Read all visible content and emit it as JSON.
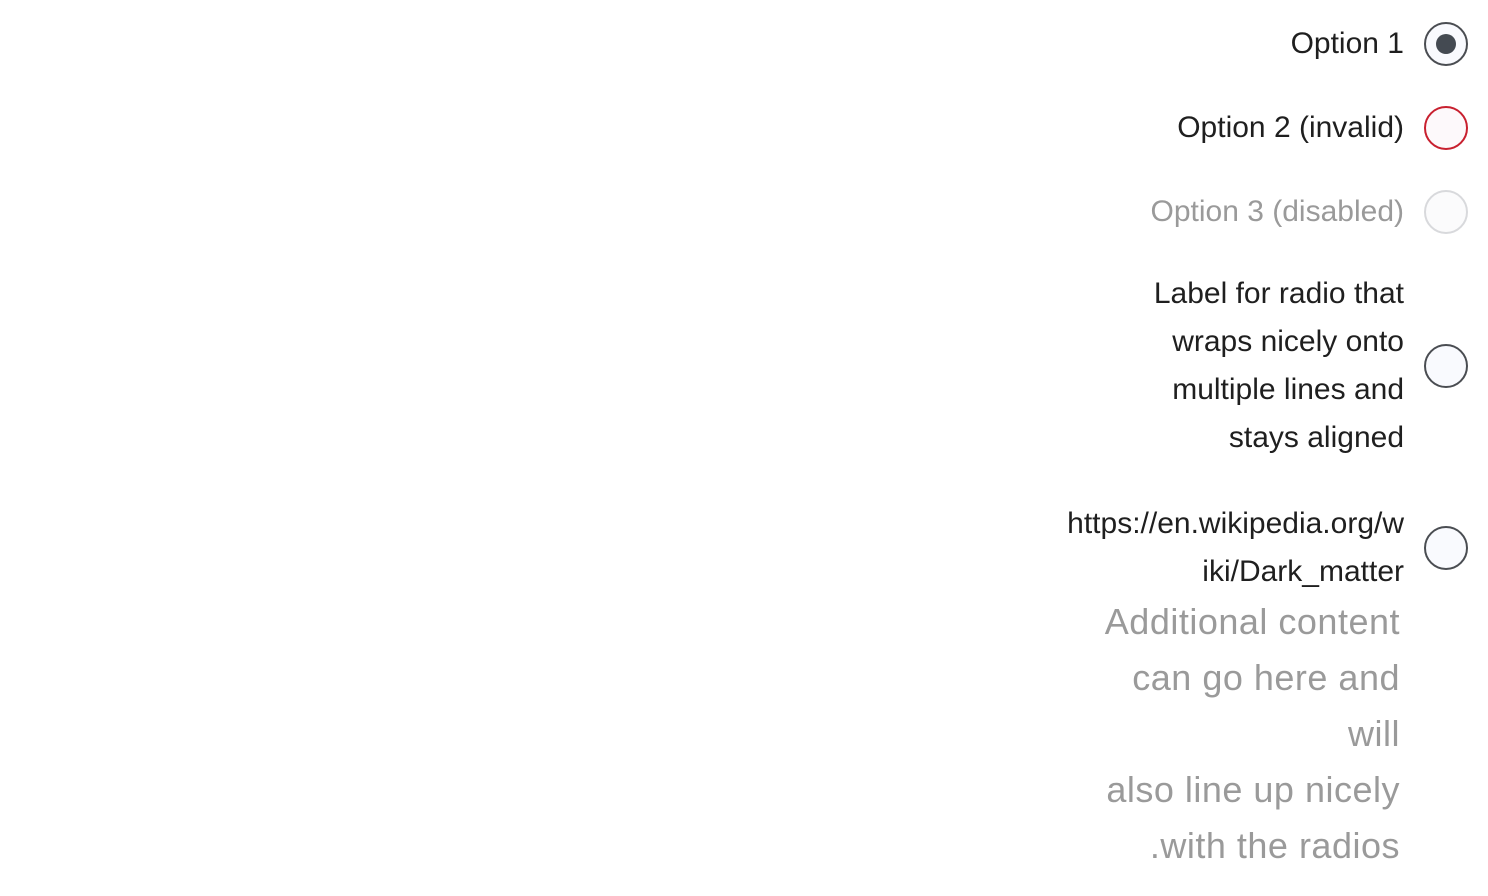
{
  "radios": [
    {
      "label": "Option 1",
      "checked": true,
      "state": "normal"
    },
    {
      "label": "Option 2 (invalid)",
      "checked": false,
      "state": "invalid"
    },
    {
      "label": "Option 3 (disabled)",
      "checked": false,
      "state": "disabled"
    },
    {
      "label": "Label for radio that wraps nicely onto multiple lines and stays aligned",
      "checked": false,
      "state": "normal"
    },
    {
      "label": "https://en.wikipedia.org/wiki/Dark_matter",
      "checked": false,
      "state": "normal"
    }
  ],
  "additional_content": {
    "lines": [
      "Additional content",
      "can go here and",
      "will",
      "also line up nicely",
      ".with the radios"
    ]
  },
  "colors": {
    "radio_border": "#4a4d52",
    "radio_fill": "#f9fafe",
    "checked_dot": "#444a52",
    "invalid_border": "#c8202f",
    "disabled_border": "#d8d9dc",
    "label_text": "#1f1f1f",
    "muted_text": "#9a9a9a"
  }
}
